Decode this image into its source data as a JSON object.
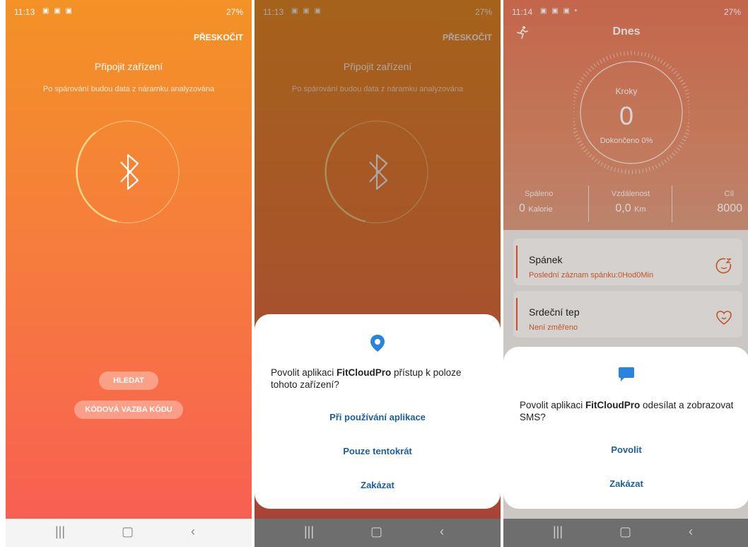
{
  "screen1": {
    "status": {
      "time": "11:13",
      "battery": "27%"
    },
    "skip_label": "PŘESKOČIT",
    "title": "Připojit zařízení",
    "subtitle": "Po spárování budou data z náramku analyzována",
    "search_button": "HLEDAT",
    "code_bind_button": "KÓDOVÁ VAZBA KÓDU"
  },
  "screen2": {
    "status": {
      "time": "11:13",
      "battery": "27%"
    },
    "skip_label": "PŘESKOČIT",
    "title": "Připojit zařízení",
    "subtitle": "Po spárování budou data z náramku analyzována",
    "dialog": {
      "text_prefix": "Povolit aplikaci ",
      "app_name": "FitCloudPro",
      "text_suffix": " přístup k poloze tohoto zařízení?",
      "options": [
        "Při používání aplikace",
        "Pouze tentokrát",
        "Zakázat"
      ]
    }
  },
  "screen3": {
    "status": {
      "time": "11:14",
      "battery": "27%"
    },
    "title": "Dnes",
    "steps_label": "Kroky",
    "steps_value": "0",
    "completed_label": "Dokončeno 0%",
    "stats": [
      {
        "label": "Spáleno",
        "value": "0",
        "unit": "Kalorie"
      },
      {
        "label": "Vzdálenost",
        "value": "0,0",
        "unit": "Km"
      },
      {
        "label": "Cíl",
        "value": "8000",
        "unit": ""
      }
    ],
    "cards": [
      {
        "title": "Spánek",
        "subtitle": "Poslední záznam spánku:0Hod0Min"
      },
      {
        "title": "Srdeční tep",
        "subtitle": "Není změřeno"
      }
    ],
    "dialog": {
      "text_prefix": "Povolit aplikaci ",
      "app_name": "FitCloudPro",
      "text_suffix": " odesílat a zobrazovat SMS?",
      "options": [
        "Povolit",
        "Zakázat"
      ]
    }
  },
  "colors": {
    "gradient_top": "#f39225",
    "gradient_bottom": "#f85f52",
    "dialog_link": "#1a5fa0",
    "accent_blue": "#2b83e0"
  },
  "icons": [
    "bluetooth-icon",
    "location-pin-icon",
    "message-icon",
    "runner-icon",
    "sleep-face-icon",
    "heart-face-icon"
  ]
}
